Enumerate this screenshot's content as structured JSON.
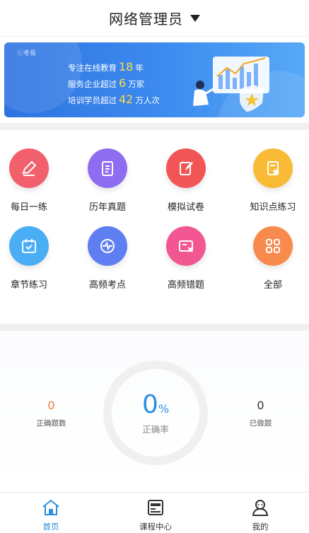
{
  "header": {
    "title": "网络管理员"
  },
  "banner": {
    "logo": "ⓒ考易",
    "line1_prefix": "专注在线教育",
    "line1_number": "18",
    "line1_suffix": "年",
    "line2_prefix": "服务企业超过",
    "line2_number": "6",
    "line2_suffix": "万家",
    "line3_prefix": "培训学员超过",
    "line3_number": "42",
    "line3_suffix": "万人次",
    "accent_color": "#ffd94a"
  },
  "menu": [
    {
      "label": "每日一练",
      "icon": "pencil-icon",
      "color": "#f2606d"
    },
    {
      "label": "历年真题",
      "icon": "clipboard-icon",
      "color": "#8f6cf0"
    },
    {
      "label": "模拟试卷",
      "icon": "edit-paper-icon",
      "color": "#f25555"
    },
    {
      "label": "知识点练习",
      "icon": "star-note-icon",
      "color": "#f9ba36"
    },
    {
      "label": "章节练习",
      "icon": "calendar-check-icon",
      "color": "#4aaef5"
    },
    {
      "label": "高频考点",
      "icon": "pulse-check-icon",
      "color": "#5f7ef2"
    },
    {
      "label": "高频错题",
      "icon": "error-card-icon",
      "color": "#f25791"
    },
    {
      "label": "全部",
      "icon": "grid-icon",
      "color": "#f98a4e"
    }
  ],
  "stats": {
    "correct_count": {
      "value": "0",
      "label": "正确题数",
      "color": "#f27d36"
    },
    "rate": {
      "value": "0",
      "unit": "%",
      "label": "正确率",
      "color": "#2b8ee0"
    },
    "done_count": {
      "value": "0",
      "label": "已做题",
      "color": "#333333"
    }
  },
  "tabbar": {
    "tabs": [
      {
        "label": "首页",
        "icon": "home-icon",
        "active": true
      },
      {
        "label": "课程中心",
        "icon": "course-icon",
        "active": false
      },
      {
        "label": "我的",
        "icon": "profile-icon",
        "active": false
      }
    ],
    "active_color": "#2b8ee0"
  }
}
